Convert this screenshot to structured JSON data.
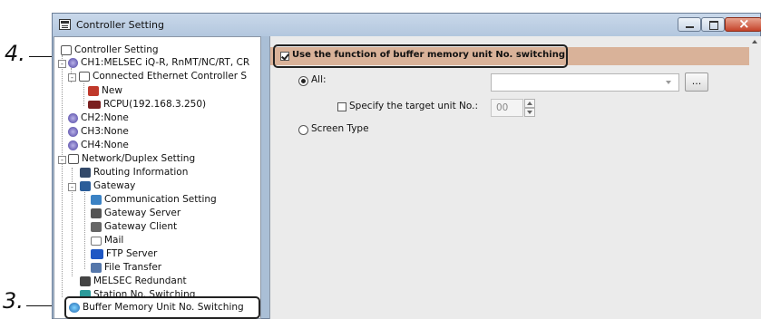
{
  "window": {
    "title": "Controller Setting"
  },
  "callouts": {
    "step4": "4.",
    "step3": "3."
  },
  "tree": {
    "root": "Controller Setting",
    "ch1": "CH1:MELSEC iQ-R, RnMT/NC/RT, CR",
    "connected": "Connected Ethernet Controller S",
    "new_item": "New",
    "rcpu": "RCPU(192.168.3.250)",
    "ch2": "CH2:None",
    "ch3": "CH3:None",
    "ch4": "CH4:None",
    "network": "Network/Duplex Setting",
    "routing": "Routing Information",
    "gateway": "Gateway",
    "comm": "Communication Setting",
    "gw_server": "Gateway Server",
    "gw_client": "Gateway Client",
    "mail": "Mail",
    "ftp": "FTP Server",
    "file_transfer": "File Transfer",
    "melsec_redundant": "MELSEC Redundant",
    "station_switching": "Station No. Switching",
    "buffer_switching": "Buffer Memory Unit No. Switching"
  },
  "settings": {
    "use_function_label": "Use the function of buffer memory unit No. switching",
    "use_function_checked": true,
    "radio_all": "All:",
    "radio_all_selected": true,
    "specify_target_label": "Specify the target unit No.:",
    "specify_target_checked": false,
    "target_unit_value": "00",
    "browse_label": "...",
    "radio_screen_type": "Screen Type"
  },
  "colors": {
    "header_bar": "#d9b299",
    "titlebar": "#c9d8ea"
  }
}
